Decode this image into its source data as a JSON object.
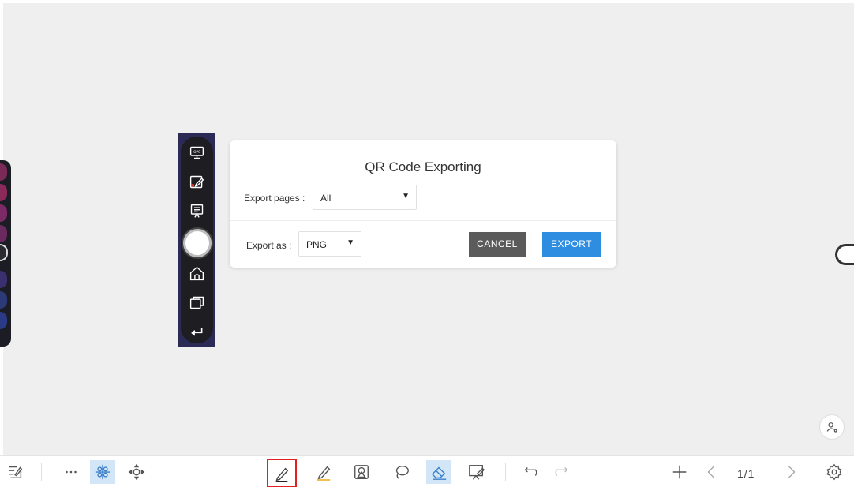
{
  "dialog": {
    "title": "QR Code Exporting",
    "export_pages_label": "Export pages :",
    "export_pages_value": "All",
    "export_as_label": "Export as :",
    "export_as_value": "PNG",
    "cancel_label": "CANCEL",
    "export_label": "EXPORT"
  },
  "side_panel": {
    "items": [
      {
        "icon": "ops-icon"
      },
      {
        "icon": "annotate-icon"
      },
      {
        "icon": "whiteboard-icon"
      },
      {
        "icon": "home-button-icon"
      },
      {
        "icon": "home-icon"
      },
      {
        "icon": "windows-icon"
      },
      {
        "icon": "back-icon"
      }
    ]
  },
  "toolbar": {
    "page_indicator": "1/1"
  },
  "colors": {
    "canvas": "#efefef",
    "accent": "#2e8de0",
    "cancel": "#5b5b5b",
    "highlighter": "#f0c14b",
    "selected_outline": "#e02020"
  }
}
